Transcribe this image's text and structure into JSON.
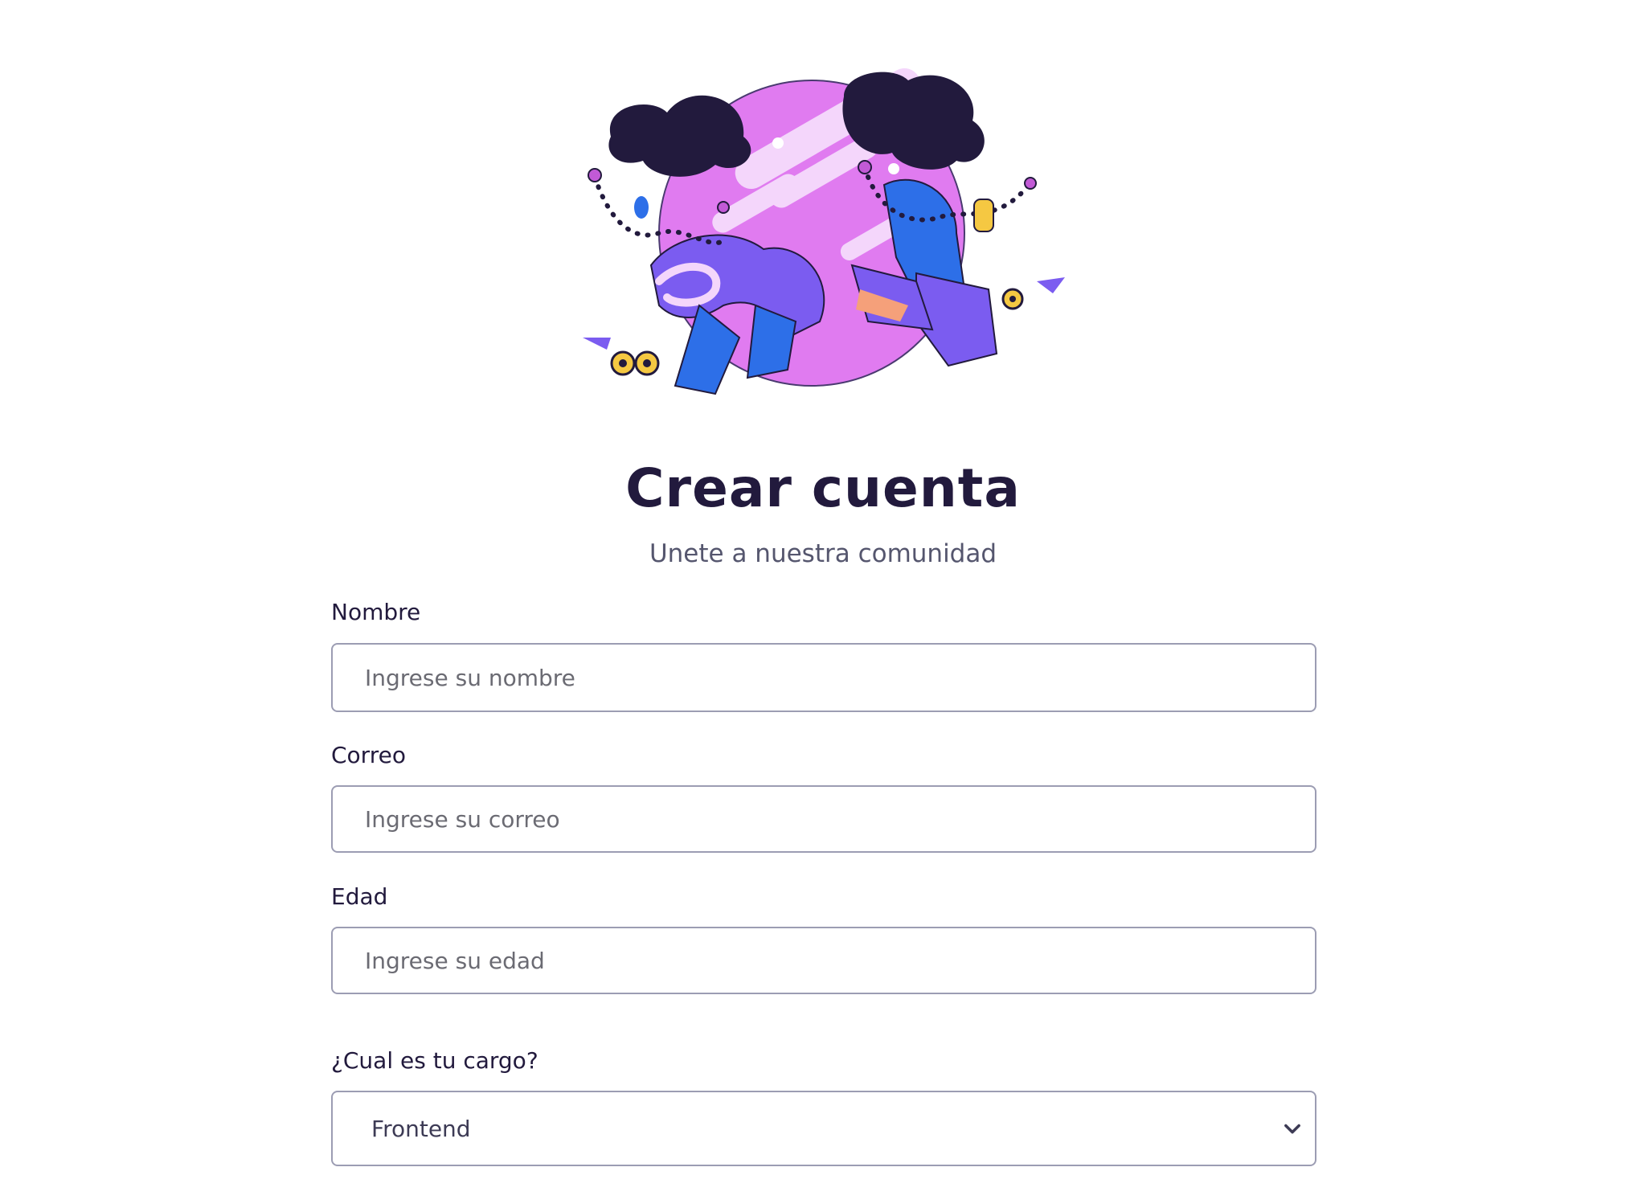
{
  "header": {
    "title": "Crear cuenta",
    "subtitle": "Unete a nuestra comunidad"
  },
  "form": {
    "nombre": {
      "label": "Nombre",
      "placeholder": "Ingrese su nombre",
      "value": ""
    },
    "correo": {
      "label": "Correo",
      "placeholder": "Ingrese su correo",
      "value": ""
    },
    "edad": {
      "label": "Edad",
      "placeholder": "Ingrese su edad",
      "value": ""
    },
    "cargo": {
      "label": "¿Cual es tu cargo?",
      "selected": "Frontend"
    }
  },
  "colors": {
    "heading": "#221a3d",
    "subtitle": "#55566e",
    "border": "#9c9db3",
    "illustration_circle": "#e07bf0",
    "illustration_purple": "#7b5cf0",
    "illustration_blue": "#2d6fe8",
    "illustration_dark": "#221a3d",
    "illustration_yellow": "#f5c842"
  },
  "icons": {
    "illustration": "skaters-illustration",
    "select": "chevron-down-icon"
  }
}
